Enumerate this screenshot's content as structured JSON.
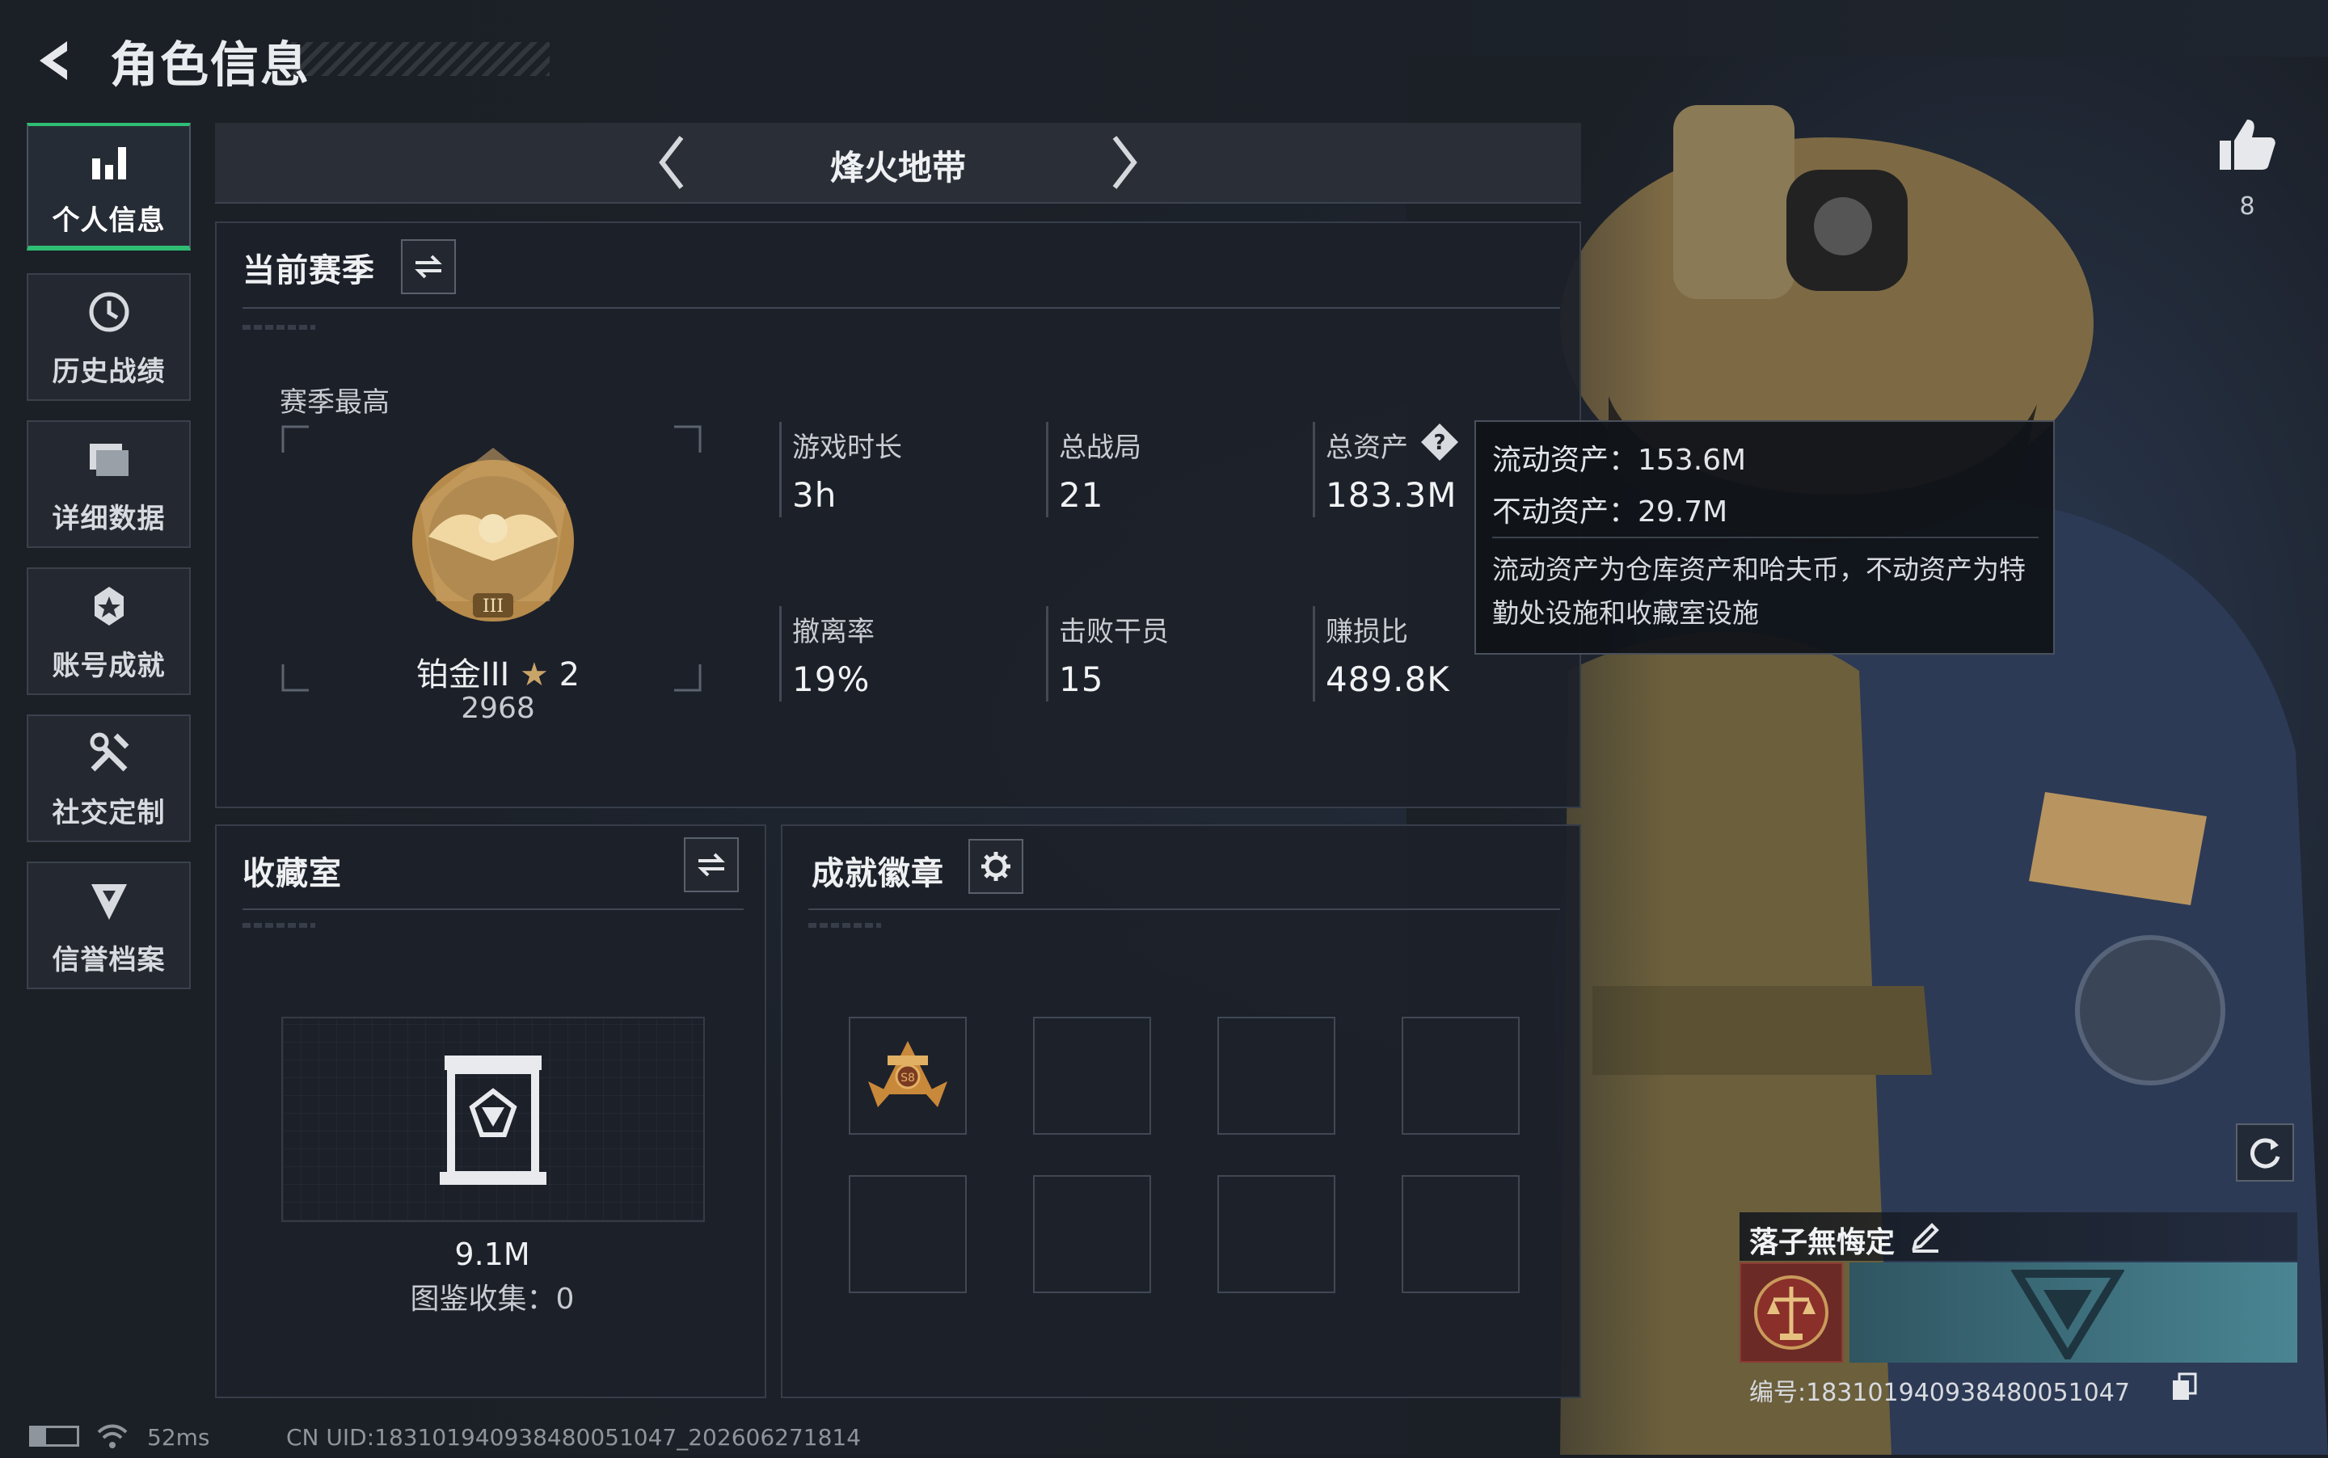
{
  "header": {
    "title": "角色信息"
  },
  "nav": [
    {
      "label": "个人信息",
      "icon": "bar-chart-icon"
    },
    {
      "label": "历史战绩",
      "icon": "history-clock-icon"
    },
    {
      "label": "详细数据",
      "icon": "folder-icon"
    },
    {
      "label": "账号成就",
      "icon": "achievement-star-icon"
    },
    {
      "label": "社交定制",
      "icon": "tools-icon"
    },
    {
      "label": "信誉档案",
      "icon": "shield-emblem-icon"
    }
  ],
  "mode": {
    "title": "烽火地带"
  },
  "season": {
    "title": "当前赛季",
    "best_label": "赛季最高",
    "rank_name": "铂金III",
    "rank_stars": "2",
    "rank_score": "2968",
    "stats": [
      {
        "label": "游戏时长",
        "value": "3h"
      },
      {
        "label": "总战局",
        "value": "21"
      },
      {
        "label": "总资产",
        "value": "183.3M"
      },
      {
        "label": "撤离率",
        "value": "19%"
      },
      {
        "label": "击败干员",
        "value": "15"
      },
      {
        "label": "赚损比",
        "value": "489.8K"
      }
    ]
  },
  "tooltip": {
    "liquid": "流动资产：153.6M",
    "fixed": "不动资产：29.7M",
    "desc": "流动资产为仓库资产和哈夫币，不动资产为特勤处设施和收藏室设施"
  },
  "collection": {
    "title": "收藏室",
    "value": "9.1M",
    "count_label": "图鉴收集：0"
  },
  "badges": {
    "title": "成就徽章"
  },
  "likes": {
    "count": "8"
  },
  "player": {
    "name": "落子無悔定",
    "id_label": "编号:183101940938480051047"
  },
  "status": {
    "ping": "52ms",
    "uid": "CN UID:183101940938480051047_202606271814"
  },
  "colors": {
    "accent": "#2fbd74",
    "panel": "#1c2129",
    "background": "#1a1e25"
  }
}
